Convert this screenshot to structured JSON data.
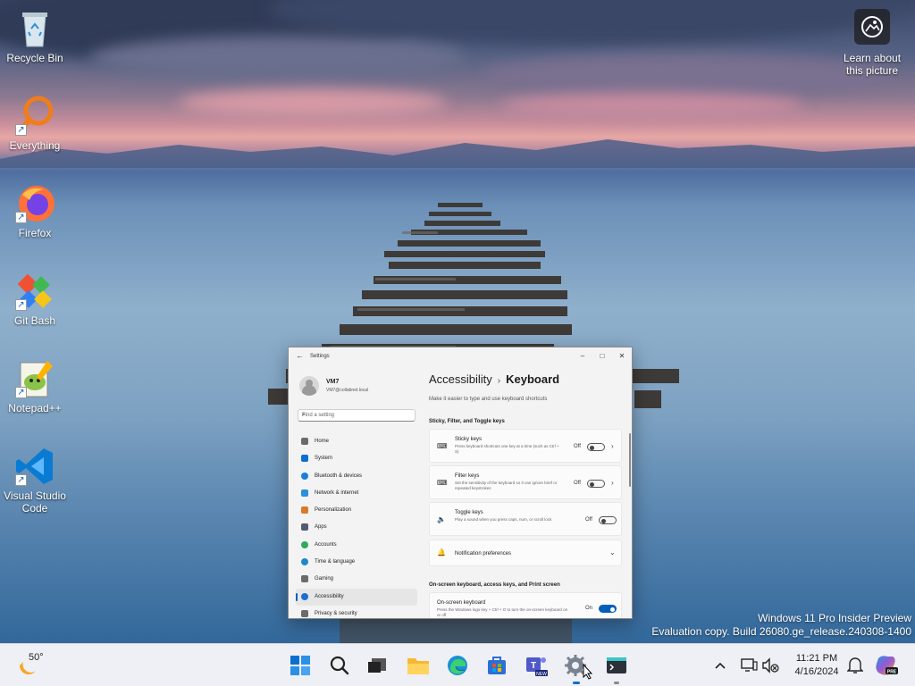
{
  "desktop": {
    "icons": [
      {
        "label": "Recycle Bin"
      },
      {
        "label": "Everything"
      },
      {
        "label": "Firefox"
      },
      {
        "label": "Git Bash"
      },
      {
        "label": "Notepad++"
      },
      {
        "label": "Visual Studio Code"
      }
    ],
    "learn_label": "Learn about this picture",
    "watermark_line1": "Windows 11 Pro Insider Preview",
    "watermark_line2": "Evaluation copy. Build 26080.ge_release.240308-1400"
  },
  "settings": {
    "window_title": "Settings",
    "user_name": "VM7",
    "user_email": "VM7@collabnet.local",
    "search_placeholder": "Find a setting",
    "nav": [
      {
        "label": "Home",
        "color": "#6b6b6b"
      },
      {
        "label": "System",
        "color": "#0a6fd1"
      },
      {
        "label": "Bluetooth & devices",
        "color": "#1a7fd9"
      },
      {
        "label": "Network & internet",
        "color": "#2b8fd9"
      },
      {
        "label": "Personalization",
        "color": "#d97a2b"
      },
      {
        "label": "Apps",
        "color": "#555b6e"
      },
      {
        "label": "Accounts",
        "color": "#2eaa5c"
      },
      {
        "label": "Time & language",
        "color": "#1e88c9"
      },
      {
        "label": "Gaming",
        "color": "#6b6b6b"
      },
      {
        "label": "Accessibility",
        "color": "#1a6fd1"
      },
      {
        "label": "Privacy & security",
        "color": "#6b6b6b"
      }
    ],
    "active_nav": "Accessibility",
    "breadcrumb_parent": "Accessibility",
    "breadcrumb_current": "Keyboard",
    "description": "Make it easier to type and use keyboard shortcuts",
    "section1": "Sticky, Filter, and Toggle keys",
    "sticky_title": "Sticky keys",
    "sticky_desc": "Press keyboard shortcuts one key at a time (such as Ctrl + S)",
    "sticky_state": "Off",
    "filter_title": "Filter keys",
    "filter_desc": "Set the sensitivity of the keyboard so it can ignore brief or repeated keystrokes",
    "filter_state": "Off",
    "toggle_title": "Toggle keys",
    "toggle_desc": "Play a sound when you press caps, num, or scroll lock",
    "toggle_state": "Off",
    "notif_title": "Notification preferences",
    "section2": "On-screen keyboard, access keys, and Print screen",
    "osk_title": "On-screen keyboard",
    "osk_desc": "Press the Windows logo key + Ctrl + O to turn the on-screen keyboard on or off",
    "osk_state": "On"
  },
  "taskbar": {
    "temperature": "50°",
    "time": "11:21 PM",
    "date": "4/16/2024",
    "pinned": [
      "start-icon",
      "search-icon",
      "task-view-icon",
      "file-explorer-icon",
      "edge-icon",
      "store-icon",
      "teams-icon",
      "settings-icon",
      "terminal-icon"
    ]
  }
}
